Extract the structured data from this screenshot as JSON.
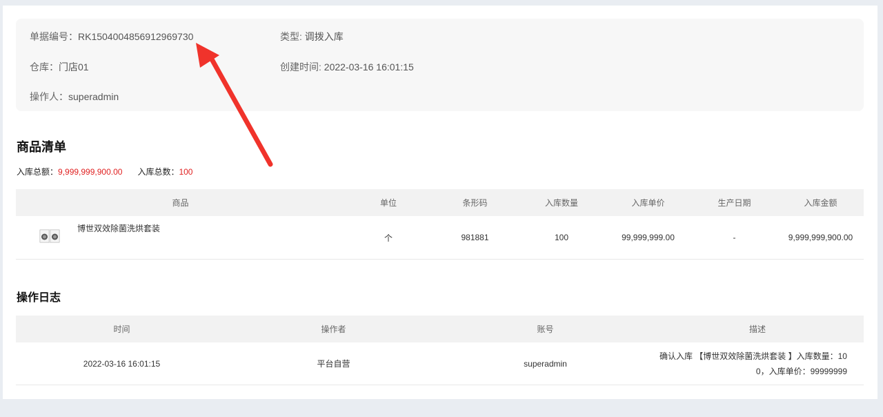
{
  "info": {
    "doc_no_label": "单据编号：",
    "doc_no_value": "RK1504004856912969730",
    "type_label": "类型: ",
    "type_value": "调拨入库",
    "warehouse_label": "仓库：",
    "warehouse_value": "门店01",
    "created_label": "创建时间: ",
    "created_value": "2022-03-16 16:01:15",
    "operator_label": "操作人：",
    "operator_value": "superadmin"
  },
  "goods": {
    "title": "商品清单",
    "total_amount_label": "入库总额：",
    "total_amount_value": "9,999,999,900.00",
    "total_qty_label": "入库总数：",
    "total_qty_value": "100",
    "columns": [
      "商品",
      "单位",
      "条形码",
      "入库数量",
      "入库单价",
      "生产日期",
      "入库金额"
    ],
    "rows": [
      {
        "name": "博世双效除菌洗烘套装",
        "unit": "个",
        "barcode": "981881",
        "qty": "100",
        "price": "99,999,999.00",
        "date": "-",
        "amount": "9,999,999,900.00"
      }
    ]
  },
  "log": {
    "title": "操作日志",
    "columns": [
      "时间",
      "操作者",
      "账号",
      "描述"
    ],
    "rows": [
      {
        "time": "2022-03-16 16:01:15",
        "operator": "平台自营",
        "account": "superadmin",
        "desc_line1": "确认入库 【博世双效除菌洗烘套装 】入库数量：10",
        "desc_line2": "0，入库单价：99999999"
      }
    ]
  },
  "colors": {
    "accent_red": "#e02020",
    "annotation_arrow": "#f0332b"
  }
}
